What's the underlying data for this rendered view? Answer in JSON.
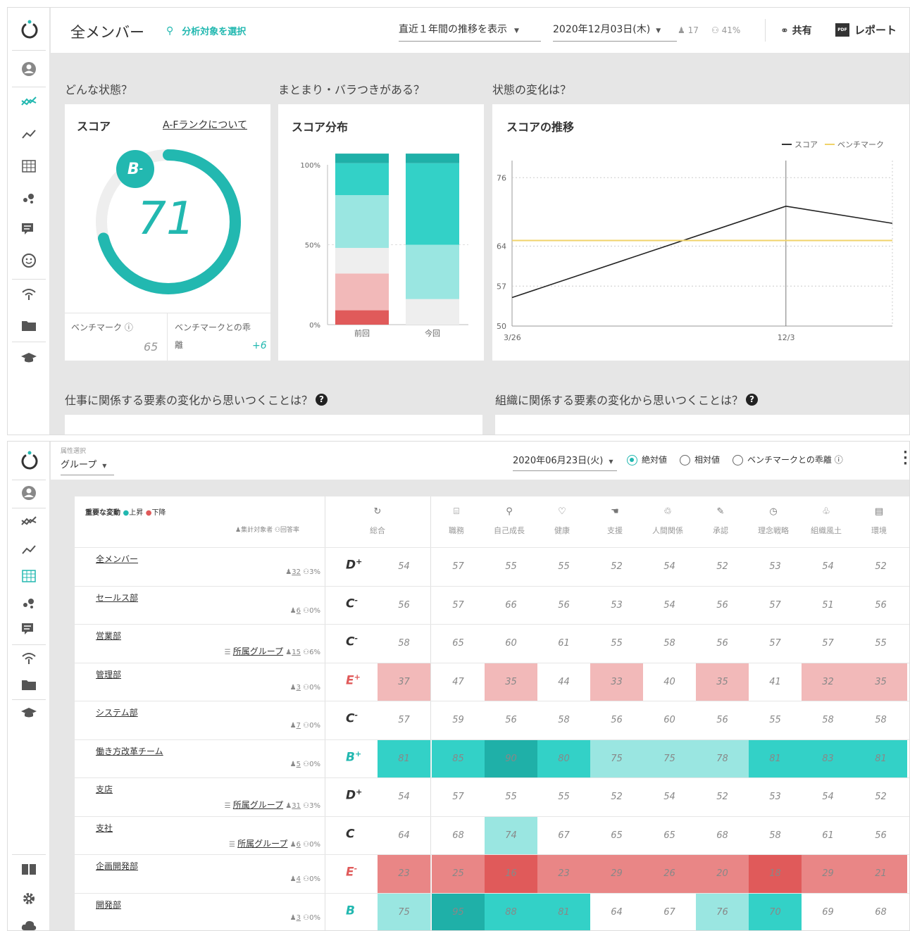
{
  "colors": {
    "accent": "#22b8b0",
    "teal_dark": "#1fb0a8",
    "teal_mid": "#33d1c7",
    "teal_light": "#9ae6e1",
    "red_dark": "#e05a5a",
    "red_mid": "#e98686",
    "red_light": "#f2b9b9",
    "bench": "#f0d36a"
  },
  "top": {
    "header": {
      "title": "全メンバー",
      "select_target": "分析対象を選択",
      "trend_select": "直近１年間の推移を表示",
      "date": "2020年12月03日(木)",
      "members": "17",
      "rate": "41%",
      "share": "共有",
      "report": "レポート"
    },
    "questions": {
      "state": "どんな状態？",
      "spread": "まとまり・バラつきがある？",
      "change": "状態の変化は？",
      "work": "仕事に関係する要素の変化から思いつくことは？",
      "org": "組織に関係する要素の変化から思いつくことは？"
    },
    "score_card": {
      "title": "スコア",
      "rank_link": "A-Fランクについて",
      "rank": "B",
      "rank_sup": "-",
      "score": "71",
      "score_fraction": 0.71,
      "bench_label": "ベンチマーク",
      "bench_value": "65",
      "diff_label": "ベンチマークとの乖",
      "diff_label2": "離",
      "diff_value": "+6"
    },
    "dist_card": {
      "title": "スコア分布"
    },
    "trend_card": {
      "title": "スコアの推移",
      "legend_score": "スコア",
      "legend_bench": "ベンチマーク"
    }
  },
  "chart_data": [
    {
      "type": "bar",
      "title": "スコア分布",
      "categories": [
        "前回",
        "今回"
      ],
      "yticks": [
        "100%",
        "50%",
        "0%"
      ],
      "stack_order": [
        "red_dark",
        "red_light",
        "gray",
        "teal_light",
        "teal_mid",
        "teal_dark"
      ],
      "segments": {
        "前回": [
          0.09,
          0.23,
          0.16,
          0.33,
          0.2,
          0.06
        ],
        "今回": [
          0,
          0,
          0.16,
          0.34,
          0.51,
          0.06
        ]
      }
    },
    {
      "type": "line",
      "title": "スコアの推移",
      "x": [
        "3/26",
        "12/3"
      ],
      "yticks": [
        "76",
        "64",
        "57",
        "50"
      ],
      "ylim": [
        50,
        79
      ],
      "series": [
        {
          "name": "スコア",
          "points": [
            [
              0,
              55
            ],
            [
              0.72,
              71
            ],
            [
              1,
              68
            ]
          ]
        },
        {
          "name": "ベンチマーク",
          "points": [
            [
              0,
              65
            ],
            [
              1,
              65
            ]
          ]
        }
      ]
    }
  ],
  "bottom": {
    "attr_label": "属性選択",
    "attr_value": "グループ",
    "date": "2020年06月23日(火)",
    "radios": [
      {
        "label": "絶対値",
        "on": true
      },
      {
        "label": "相対値",
        "on": false
      },
      {
        "label": "ベンチマークとの乖離",
        "on": false
      }
    ],
    "legend": {
      "title": "重要な変動",
      "up": "上昇",
      "down": "下降",
      "count": "集計対象者",
      "rate": "回答率"
    },
    "columns": [
      {
        "label": "総合",
        "icon": "↻"
      },
      {
        "label": "職務",
        "icon": "⌸"
      },
      {
        "label": "自己成長",
        "icon": "⚲"
      },
      {
        "label": "健康",
        "icon": "♡"
      },
      {
        "label": "支援",
        "icon": "☚"
      },
      {
        "label": "人間関係",
        "icon": "♲"
      },
      {
        "label": "承認",
        "icon": "✎"
      },
      {
        "label": "理念戦略",
        "icon": "◷"
      },
      {
        "label": "組織風土",
        "icon": "♧"
      },
      {
        "label": "環境",
        "icon": "▤"
      }
    ],
    "rows": [
      {
        "name": "全メンバー",
        "group": "",
        "count": "32",
        "rate": "3%",
        "rank": "D",
        "sup": "+",
        "rc": "#333",
        "v": [
          "54",
          "57",
          "55",
          "55",
          "52",
          "54",
          "52",
          "53",
          "54",
          "52"
        ],
        "c": [
          "",
          "",
          "",
          "",
          "",
          "",
          "",
          "",
          "",
          ""
        ]
      },
      {
        "name": "セールス部",
        "group": "",
        "count": "6",
        "rate": "0%",
        "rank": "C",
        "sup": "-",
        "rc": "#333",
        "v": [
          "56",
          "57",
          "66",
          "56",
          "53",
          "54",
          "56",
          "57",
          "51",
          "56"
        ],
        "c": [
          "",
          "",
          "",
          "",
          "",
          "",
          "",
          "",
          "",
          ""
        ]
      },
      {
        "name": "営業部",
        "group": "所属グループ",
        "count": "15",
        "rate": "6%",
        "rank": "C",
        "sup": "-",
        "rc": "#333",
        "v": [
          "58",
          "65",
          "60",
          "61",
          "55",
          "58",
          "56",
          "57",
          "57",
          "55"
        ],
        "c": [
          "",
          "",
          "",
          "",
          "",
          "",
          "",
          "",
          "",
          ""
        ]
      },
      {
        "name": "管理部",
        "group": "",
        "count": "3",
        "rate": "0%",
        "rank": "E",
        "sup": "+",
        "rc": "#e05a5a",
        "v": [
          "37",
          "47",
          "35",
          "44",
          "33",
          "40",
          "35",
          "41",
          "32",
          "35"
        ],
        "c": [
          "rl",
          "",
          "rl",
          "",
          "rl",
          "",
          "rl",
          "",
          "rl",
          "rl"
        ]
      },
      {
        "name": "システム部",
        "group": "",
        "count": "7",
        "rate": "0%",
        "rank": "C",
        "sup": "-",
        "rc": "#333",
        "v": [
          "57",
          "59",
          "56",
          "58",
          "56",
          "60",
          "56",
          "55",
          "58",
          "58"
        ],
        "c": [
          "",
          "",
          "",
          "",
          "",
          "",
          "",
          "",
          "",
          ""
        ]
      },
      {
        "name": "働き方改革チーム",
        "group": "",
        "count": "5",
        "rate": "0%",
        "rank": "B",
        "sup": "+",
        "rc": "#22b8b0",
        "v": [
          "81",
          "85",
          "90",
          "80",
          "75",
          "75",
          "78",
          "81",
          "83",
          "81"
        ],
        "c": [
          "tm",
          "tm",
          "td",
          "tm",
          "tl",
          "tl",
          "tl",
          "tm",
          "tm",
          "tm"
        ]
      },
      {
        "name": "支店",
        "group": "所属グループ",
        "count": "31",
        "rate": "3%",
        "rank": "D",
        "sup": "+",
        "rc": "#333",
        "v": [
          "54",
          "57",
          "55",
          "55",
          "52",
          "54",
          "52",
          "53",
          "54",
          "52"
        ],
        "c": [
          "",
          "",
          "",
          "",
          "",
          "",
          "",
          "",
          "",
          ""
        ]
      },
      {
        "name": "支社",
        "group": "所属グループ",
        "count": "6",
        "rate": "0%",
        "rank": "C",
        "sup": "",
        "rc": "#333",
        "v": [
          "64",
          "68",
          "74",
          "67",
          "65",
          "65",
          "68",
          "58",
          "61",
          "56"
        ],
        "c": [
          "",
          "",
          "tl",
          "",
          "",
          "",
          "",
          "",
          "",
          ""
        ]
      },
      {
        "name": "企画開発部",
        "group": "",
        "count": "4",
        "rate": "0%",
        "rank": "E",
        "sup": "-",
        "rc": "#e05a5a",
        "v": [
          "23",
          "25",
          "16",
          "23",
          "29",
          "26",
          "20",
          "18",
          "29",
          "21"
        ],
        "c": [
          "rm",
          "rm",
          "rd",
          "rm",
          "rm",
          "rm",
          "rm",
          "rd",
          "rm",
          "rm"
        ]
      },
      {
        "name": "開発部",
        "group": "",
        "count": "3",
        "rate": "0%",
        "rank": "B",
        "sup": "",
        "rc": "#22b8b0",
        "v": [
          "75",
          "95",
          "88",
          "81",
          "64",
          "67",
          "76",
          "70",
          "69",
          "68"
        ],
        "c": [
          "tl",
          "td",
          "tm",
          "tm",
          "",
          "",
          "tl",
          "tm",
          "",
          ""
        ]
      }
    ]
  }
}
